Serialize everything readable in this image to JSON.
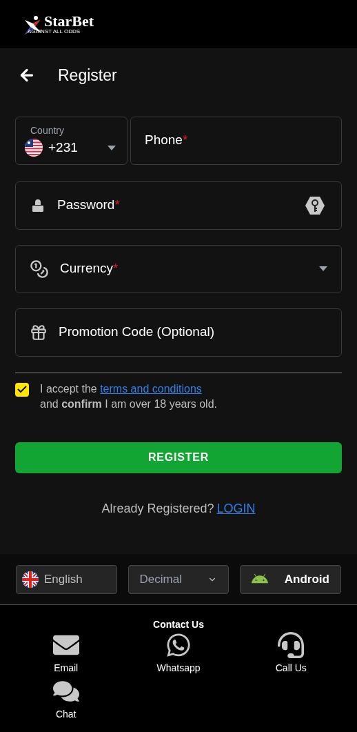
{
  "header": {
    "logo_name": "StarBet",
    "logo_tagline": "AGAINST ALL ODDS"
  },
  "page_title": "Register",
  "country": {
    "label": "Country",
    "value": "+231"
  },
  "fields": [
    {
      "kind": "phone",
      "label": "Phone",
      "required_mark": "*"
    },
    {
      "kind": "password",
      "label": "Password",
      "required_mark": "*"
    },
    {
      "kind": "currency",
      "label": "Currency",
      "required_mark": "*"
    },
    {
      "kind": "promo",
      "label": "Promotion Code (Optional)"
    }
  ],
  "terms": {
    "checked": true,
    "text_before": "I accept the ",
    "link": "terms and conditions",
    "text_after": "and **confirm** I am over 18 years old."
  },
  "register_button": "REGISTER",
  "login_prompt": {
    "text": "Already Registered?",
    "link": "LOGIN"
  },
  "footer": {
    "language": "English",
    "odds_format": "Decimal",
    "app": "Android"
  },
  "contact": {
    "title": "Contact Us",
    "items": [
      {
        "kind": "email",
        "label": "Email"
      },
      {
        "kind": "whatsapp",
        "label": "Whatsapp"
      },
      {
        "kind": "call",
        "label": "Call Us"
      },
      {
        "kind": "chat",
        "label": "Chat"
      }
    ]
  }
}
